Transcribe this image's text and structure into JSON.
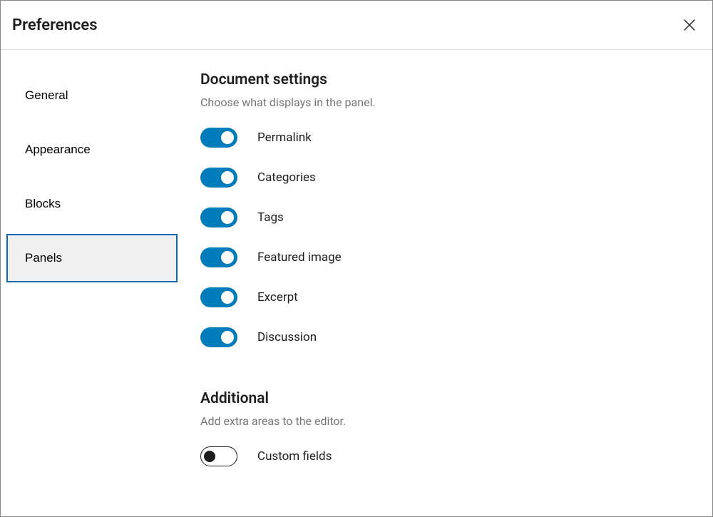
{
  "title": "Preferences",
  "tabs": [
    {
      "label": "General"
    },
    {
      "label": "Appearance"
    },
    {
      "label": "Blocks"
    },
    {
      "label": "Panels"
    }
  ],
  "section1": {
    "heading": "Document settings",
    "description": "Choose what displays in the panel.",
    "items": [
      {
        "label": "Permalink",
        "on": true
      },
      {
        "label": "Categories",
        "on": true
      },
      {
        "label": "Tags",
        "on": true
      },
      {
        "label": "Featured image",
        "on": true
      },
      {
        "label": "Excerpt",
        "on": true
      },
      {
        "label": "Discussion",
        "on": true
      }
    ]
  },
  "section2": {
    "heading": "Additional",
    "description": "Add extra areas to the editor.",
    "items": [
      {
        "label": "Custom fields",
        "on": false
      }
    ]
  }
}
